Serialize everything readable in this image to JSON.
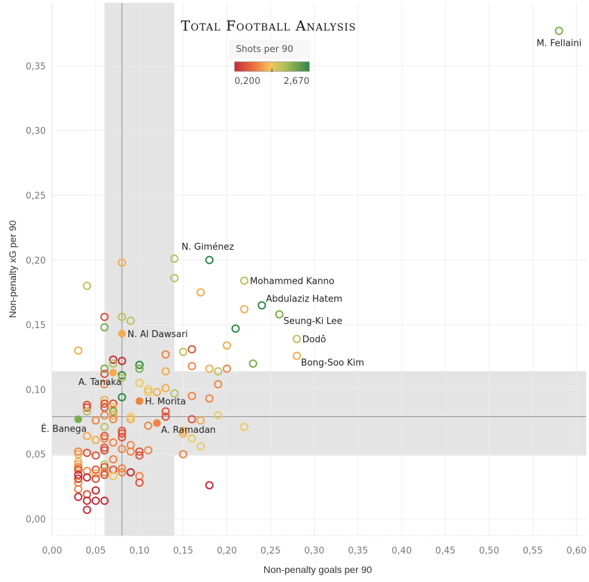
{
  "brand": "Total Football Analysis",
  "chart_data": {
    "type": "scatter",
    "title": "",
    "xlabel": "Non-penalty goals per 90",
    "ylabel": "Non-penalty xG per 90",
    "xlim": [
      -0.005,
      0.61
    ],
    "ylim": [
      -0.015,
      0.395
    ],
    "x_ticks": [
      0,
      0.05,
      0.1,
      0.15,
      0.2,
      0.25,
      0.3,
      0.35,
      0.4,
      0.45,
      0.5,
      0.55,
      0.6
    ],
    "x_tick_labels": [
      "0,00",
      "0,05",
      "0,10",
      "0,15",
      "0,20",
      "0,25",
      "0,30",
      "0,35",
      "0,40",
      "0,45",
      "0,50",
      "0,55",
      "0,60"
    ],
    "y_ticks": [
      0,
      0.05,
      0.1,
      0.15,
      0.2,
      0.25,
      0.3,
      0.35
    ],
    "y_tick_labels": [
      "0,00",
      "0,05",
      "0,10",
      "0,15",
      "0,20",
      "0,25",
      "0,30",
      "0,35"
    ],
    "grid": true,
    "reference_bands": {
      "x_band": [
        0.06,
        0.14
      ],
      "y_band": [
        0.049,
        0.114
      ],
      "x_median": 0.08,
      "y_median": 0.079
    },
    "color_legend": {
      "title": "Shots per 90",
      "min_label": "0,200",
      "max_label": "2,670",
      "min": 0.2,
      "max": 2.67,
      "placement": "top-center"
    },
    "palette": [
      "#c42a35",
      "#de5138",
      "#ef8443",
      "#f4ab4f",
      "#efc85c",
      "#b9c25a",
      "#79ae4d",
      "#2d8646"
    ],
    "labeled_points": [
      {
        "name": "M. Fellaini",
        "x": 0.58,
        "y": 0.377,
        "c": 6,
        "filled": false,
        "pos": "below"
      },
      {
        "name": "N. Giménez",
        "x": 0.18,
        "y": 0.2,
        "c": 7,
        "filled": false,
        "pos": "above-left"
      },
      {
        "name": "Mohammed Kanno",
        "x": 0.22,
        "y": 0.184,
        "c": 5,
        "filled": false,
        "pos": "right"
      },
      {
        "name": "Abdulaziz Hatem",
        "x": 0.24,
        "y": 0.165,
        "c": 7,
        "filled": false,
        "pos": "right-up"
      },
      {
        "name": "Seung-Ki Lee",
        "x": 0.26,
        "y": 0.158,
        "c": 6,
        "filled": false,
        "pos": "right-down"
      },
      {
        "name": "Dodô",
        "x": 0.28,
        "y": 0.139,
        "c": 5,
        "filled": false,
        "pos": "right"
      },
      {
        "name": "Bong-Soo Kim",
        "x": 0.28,
        "y": 0.126,
        "c": 3,
        "filled": false,
        "pos": "right-down"
      },
      {
        "name": "N. Al Dawsari",
        "x": 0.08,
        "y": 0.143,
        "c": 3,
        "filled": true,
        "pos": "right"
      },
      {
        "name": "A. Tanaka",
        "x": 0.07,
        "y": 0.113,
        "c": 3,
        "filled": true,
        "pos": "below-left"
      },
      {
        "name": "H. Morita",
        "x": 0.1,
        "y": 0.091,
        "c": 2,
        "filled": true,
        "pos": "right"
      },
      {
        "name": "A. Ramadan",
        "x": 0.12,
        "y": 0.074,
        "c": 2,
        "filled": true,
        "pos": "right-down"
      },
      {
        "name": "É. Banega",
        "x": 0.03,
        "y": 0.077,
        "c": 6,
        "filled": true,
        "pos": "below-left"
      }
    ],
    "points": [
      {
        "x": 0.08,
        "y": 0.198,
        "c": 3
      },
      {
        "x": 0.14,
        "y": 0.201,
        "c": 5
      },
      {
        "x": 0.14,
        "y": 0.186,
        "c": 5
      },
      {
        "x": 0.04,
        "y": 0.18,
        "c": 5
      },
      {
        "x": 0.17,
        "y": 0.175,
        "c": 3
      },
      {
        "x": 0.22,
        "y": 0.162,
        "c": 3
      },
      {
        "x": 0.21,
        "y": 0.147,
        "c": 7
      },
      {
        "x": 0.06,
        "y": 0.156,
        "c": 1
      },
      {
        "x": 0.06,
        "y": 0.148,
        "c": 6
      },
      {
        "x": 0.08,
        "y": 0.156,
        "c": 5
      },
      {
        "x": 0.09,
        "y": 0.153,
        "c": 5
      },
      {
        "x": 0.03,
        "y": 0.13,
        "c": 3
      },
      {
        "x": 0.2,
        "y": 0.134,
        "c": 3
      },
      {
        "x": 0.16,
        "y": 0.131,
        "c": 1
      },
      {
        "x": 0.15,
        "y": 0.129,
        "c": 5
      },
      {
        "x": 0.13,
        "y": 0.127,
        "c": 2
      },
      {
        "x": 0.07,
        "y": 0.123,
        "c": 0
      },
      {
        "x": 0.08,
        "y": 0.122,
        "c": 0
      },
      {
        "x": 0.07,
        "y": 0.12,
        "c": 5
      },
      {
        "x": 0.1,
        "y": 0.119,
        "c": 7
      },
      {
        "x": 0.1,
        "y": 0.116,
        "c": 6
      },
      {
        "x": 0.06,
        "y": 0.116,
        "c": 6
      },
      {
        "x": 0.23,
        "y": 0.12,
        "c": 6
      },
      {
        "x": 0.16,
        "y": 0.118,
        "c": 2
      },
      {
        "x": 0.18,
        "y": 0.116,
        "c": 3
      },
      {
        "x": 0.2,
        "y": 0.116,
        "c": 2
      },
      {
        "x": 0.19,
        "y": 0.114,
        "c": 5
      },
      {
        "x": 0.13,
        "y": 0.114,
        "c": 3
      },
      {
        "x": 0.06,
        "y": 0.112,
        "c": 1
      },
      {
        "x": 0.08,
        "y": 0.111,
        "c": 7
      },
      {
        "x": 0.08,
        "y": 0.109,
        "c": 5
      },
      {
        "x": 0.06,
        "y": 0.104,
        "c": 2
      },
      {
        "x": 0.1,
        "y": 0.105,
        "c": 4
      },
      {
        "x": 0.19,
        "y": 0.104,
        "c": 2
      },
      {
        "x": 0.11,
        "y": 0.1,
        "c": 4
      },
      {
        "x": 0.11,
        "y": 0.098,
        "c": 4
      },
      {
        "x": 0.12,
        "y": 0.098,
        "c": 3
      },
      {
        "x": 0.13,
        "y": 0.101,
        "c": 3
      },
      {
        "x": 0.14,
        "y": 0.097,
        "c": 5
      },
      {
        "x": 0.16,
        "y": 0.095,
        "c": 2
      },
      {
        "x": 0.18,
        "y": 0.093,
        "c": 2
      },
      {
        "x": 0.08,
        "y": 0.094,
        "c": 7
      },
      {
        "x": 0.06,
        "y": 0.092,
        "c": 3
      },
      {
        "x": 0.04,
        "y": 0.088,
        "c": 1
      },
      {
        "x": 0.04,
        "y": 0.086,
        "c": 1
      },
      {
        "x": 0.04,
        "y": 0.083,
        "c": 5
      },
      {
        "x": 0.06,
        "y": 0.089,
        "c": 1
      },
      {
        "x": 0.06,
        "y": 0.086,
        "c": 1
      },
      {
        "x": 0.07,
        "y": 0.089,
        "c": 1
      },
      {
        "x": 0.07,
        "y": 0.086,
        "c": 4
      },
      {
        "x": 0.07,
        "y": 0.083,
        "c": 6
      },
      {
        "x": 0.07,
        "y": 0.08,
        "c": 3
      },
      {
        "x": 0.07,
        "y": 0.077,
        "c": 2
      },
      {
        "x": 0.06,
        "y": 0.08,
        "c": 2
      },
      {
        "x": 0.09,
        "y": 0.079,
        "c": 4
      },
      {
        "x": 0.09,
        "y": 0.077,
        "c": 3
      },
      {
        "x": 0.05,
        "y": 0.076,
        "c": 2
      },
      {
        "x": 0.06,
        "y": 0.071,
        "c": 5
      },
      {
        "x": 0.11,
        "y": 0.072,
        "c": 2
      },
      {
        "x": 0.13,
        "y": 0.079,
        "c": 1
      },
      {
        "x": 0.13,
        "y": 0.083,
        "c": 1
      },
      {
        "x": 0.16,
        "y": 0.077,
        "c": 1
      },
      {
        "x": 0.17,
        "y": 0.076,
        "c": 3
      },
      {
        "x": 0.19,
        "y": 0.08,
        "c": 4
      },
      {
        "x": 0.22,
        "y": 0.071,
        "c": 4
      },
      {
        "x": 0.15,
        "y": 0.068,
        "c": 3
      },
      {
        "x": 0.15,
        "y": 0.066,
        "c": 3
      },
      {
        "x": 0.16,
        "y": 0.062,
        "c": 4
      },
      {
        "x": 0.17,
        "y": 0.056,
        "c": 4
      },
      {
        "x": 0.15,
        "y": 0.05,
        "c": 2
      },
      {
        "x": 0.04,
        "y": 0.064,
        "c": 3
      },
      {
        "x": 0.06,
        "y": 0.064,
        "c": 1
      },
      {
        "x": 0.06,
        "y": 0.062,
        "c": 2
      },
      {
        "x": 0.08,
        "y": 0.068,
        "c": 1
      },
      {
        "x": 0.08,
        "y": 0.066,
        "c": 1
      },
      {
        "x": 0.08,
        "y": 0.063,
        "c": 1
      },
      {
        "x": 0.05,
        "y": 0.061,
        "c": 3
      },
      {
        "x": 0.07,
        "y": 0.059,
        "c": 2
      },
      {
        "x": 0.06,
        "y": 0.055,
        "c": 1
      },
      {
        "x": 0.06,
        "y": 0.053,
        "c": 1
      },
      {
        "x": 0.08,
        "y": 0.054,
        "c": 2
      },
      {
        "x": 0.09,
        "y": 0.057,
        "c": 2
      },
      {
        "x": 0.09,
        "y": 0.052,
        "c": 2
      },
      {
        "x": 0.1,
        "y": 0.052,
        "c": 1
      },
      {
        "x": 0.1,
        "y": 0.049,
        "c": 1
      },
      {
        "x": 0.11,
        "y": 0.053,
        "c": 2
      },
      {
        "x": 0.03,
        "y": 0.052,
        "c": 2
      },
      {
        "x": 0.03,
        "y": 0.05,
        "c": 3
      },
      {
        "x": 0.04,
        "y": 0.051,
        "c": 1
      },
      {
        "x": 0.05,
        "y": 0.049,
        "c": 1
      },
      {
        "x": 0.06,
        "y": 0.042,
        "c": 5
      },
      {
        "x": 0.06,
        "y": 0.04,
        "c": 1
      },
      {
        "x": 0.07,
        "y": 0.046,
        "c": 2
      },
      {
        "x": 0.03,
        "y": 0.044,
        "c": 3
      },
      {
        "x": 0.03,
        "y": 0.042,
        "c": 3
      },
      {
        "x": 0.03,
        "y": 0.04,
        "c": 2
      },
      {
        "x": 0.03,
        "y": 0.038,
        "c": 1
      },
      {
        "x": 0.04,
        "y": 0.037,
        "c": 2
      },
      {
        "x": 0.05,
        "y": 0.038,
        "c": 1
      },
      {
        "x": 0.05,
        "y": 0.035,
        "c": 3
      },
      {
        "x": 0.06,
        "y": 0.036,
        "c": 2
      },
      {
        "x": 0.06,
        "y": 0.034,
        "c": 1
      },
      {
        "x": 0.07,
        "y": 0.038,
        "c": 1
      },
      {
        "x": 0.07,
        "y": 0.033,
        "c": 4
      },
      {
        "x": 0.08,
        "y": 0.039,
        "c": 2
      },
      {
        "x": 0.08,
        "y": 0.036,
        "c": 2
      },
      {
        "x": 0.09,
        "y": 0.036,
        "c": 0
      },
      {
        "x": 0.1,
        "y": 0.033,
        "c": 2
      },
      {
        "x": 0.1,
        "y": 0.028,
        "c": 1
      },
      {
        "x": 0.03,
        "y": 0.034,
        "c": 0
      },
      {
        "x": 0.03,
        "y": 0.031,
        "c": 0
      },
      {
        "x": 0.03,
        "y": 0.028,
        "c": 2
      },
      {
        "x": 0.03,
        "y": 0.023,
        "c": 2
      },
      {
        "x": 0.04,
        "y": 0.032,
        "c": 0
      },
      {
        "x": 0.05,
        "y": 0.031,
        "c": 1
      },
      {
        "x": 0.05,
        "y": 0.022,
        "c": 0
      },
      {
        "x": 0.03,
        "y": 0.017,
        "c": 0
      },
      {
        "x": 0.04,
        "y": 0.019,
        "c": 1
      },
      {
        "x": 0.04,
        "y": 0.014,
        "c": 0
      },
      {
        "x": 0.05,
        "y": 0.014,
        "c": 0
      },
      {
        "x": 0.06,
        "y": 0.014,
        "c": 0
      },
      {
        "x": 0.04,
        "y": 0.007,
        "c": 0
      },
      {
        "x": 0.18,
        "y": 0.026,
        "c": 0
      }
    ]
  }
}
